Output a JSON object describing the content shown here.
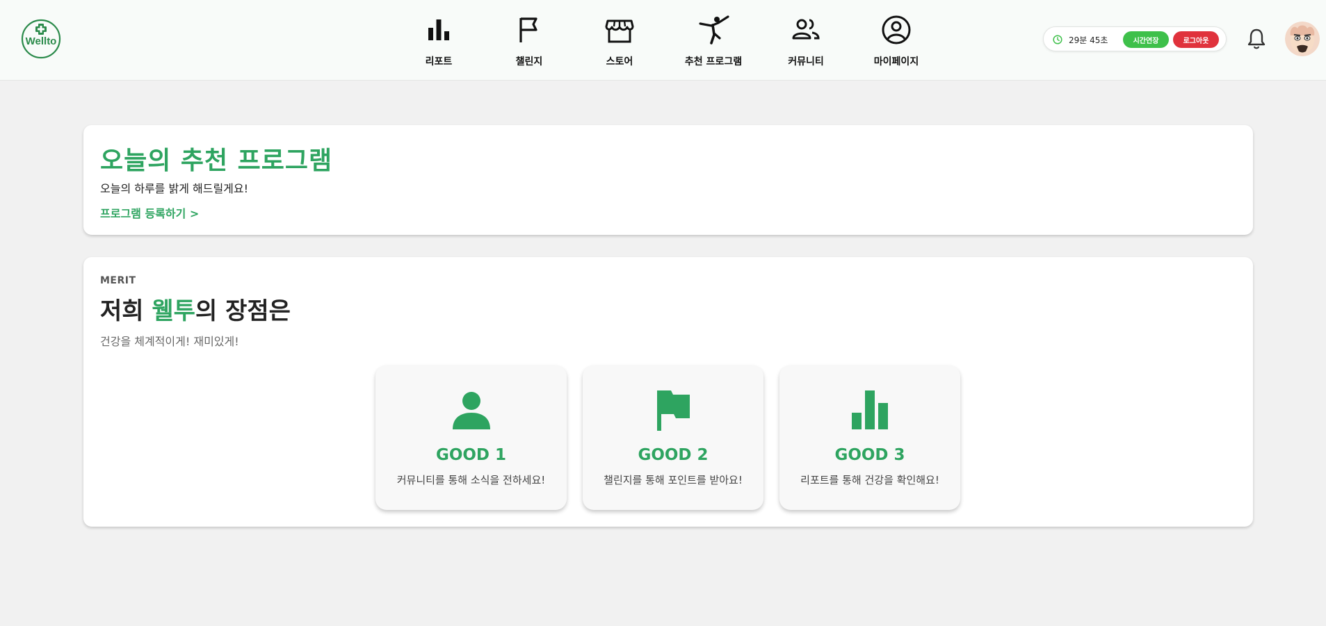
{
  "header": {
    "logo_text": "Wellto",
    "nav": [
      {
        "label": "리포트",
        "icon": "bar-chart-icon"
      },
      {
        "label": "챌린지",
        "icon": "flag-icon"
      },
      {
        "label": "스토어",
        "icon": "store-icon"
      },
      {
        "label": "추천 프로그램",
        "icon": "kick-person-icon"
      },
      {
        "label": "커뮤니티",
        "icon": "people-icon"
      },
      {
        "label": "마이페이지",
        "icon": "account-circle-icon"
      }
    ],
    "session": {
      "timer": "29분 45초",
      "extend_label": "시간연장",
      "logout_label": "로그아웃"
    },
    "colors": {
      "brand_green": "#2ea460",
      "extend_green": "#3ec04a",
      "logout_red": "#e0323c"
    }
  },
  "program": {
    "title": "오늘의 추천 프로그램",
    "subtitle": "오늘의 하루를 밝게 해드릴게요!",
    "link": "프로그램 등록하기 >"
  },
  "merit": {
    "eyebrow": "MERIT",
    "title_prefix": "저희 ",
    "title_accent": "웰투",
    "title_suffix": "의 장점은",
    "subtitle": "건강을 체계적이게! 재미있게!",
    "cards": [
      {
        "title": "GOOD 1",
        "desc": "커뮤니티를 통해 소식을 전하세요!",
        "icon": "person-icon"
      },
      {
        "title": "GOOD 2",
        "desc": "챌린지를 통해 포인트를 받아요!",
        "icon": "flag-icon"
      },
      {
        "title": "GOOD 3",
        "desc": "리포트를 통해 건강을 확인해요!",
        "icon": "bar-chart-icon"
      }
    ]
  }
}
